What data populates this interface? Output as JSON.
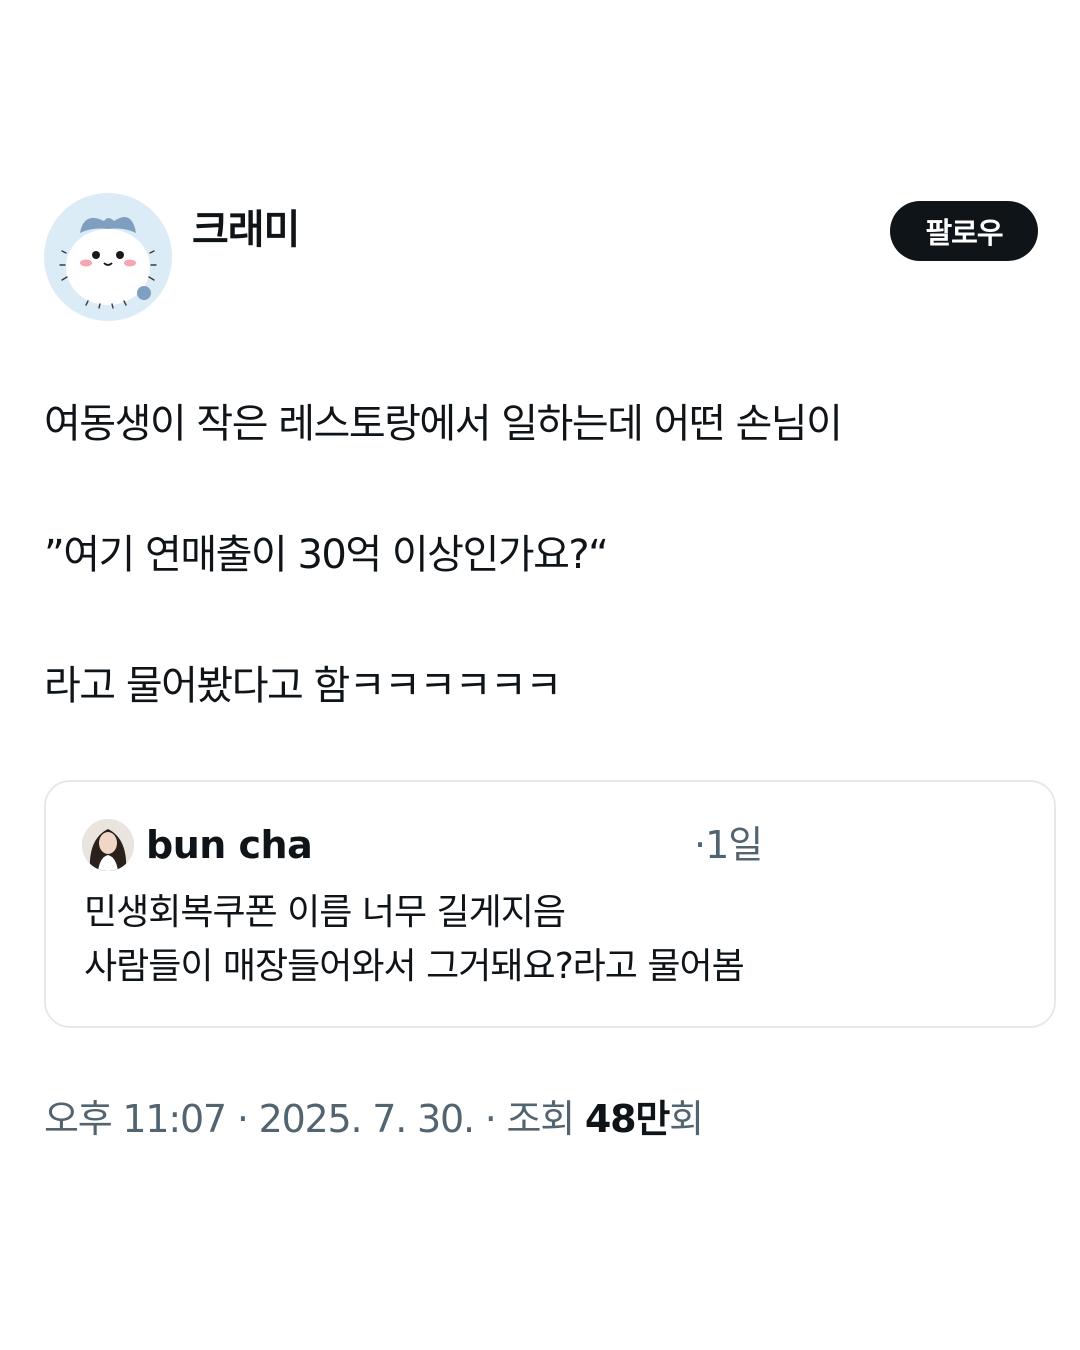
{
  "author": {
    "display_name": "크래미",
    "avatar": "fluffy-white-creature-avatar"
  },
  "follow_button": {
    "label": "팔로우"
  },
  "post": {
    "lines": [
      "여동생이 작은 레스토랑에서 일하는데 어떤 손님이",
      "”여기 연매출이 30억 이상인가요?“",
      "라고 물어봤다고 함ㅋㅋㅋㅋㅋㅋ"
    ]
  },
  "quote": {
    "author_name": "bun cha",
    "time": "·1일",
    "lines": [
      "민생회복쿠폰 이름 너무 길게지음",
      "사람들이 매장들어와서 그거돼요?라고 물어봄"
    ]
  },
  "meta": {
    "time": "오후 11:07",
    "date": "2025. 7. 30.",
    "views_label": "조회",
    "views_count": "48만",
    "views_suffix": "회",
    "separator": "·"
  },
  "colors": {
    "text": "#0f1419",
    "secondary_text": "#536471",
    "border": "#e6e9ec",
    "button_bg": "#0f1419"
  }
}
